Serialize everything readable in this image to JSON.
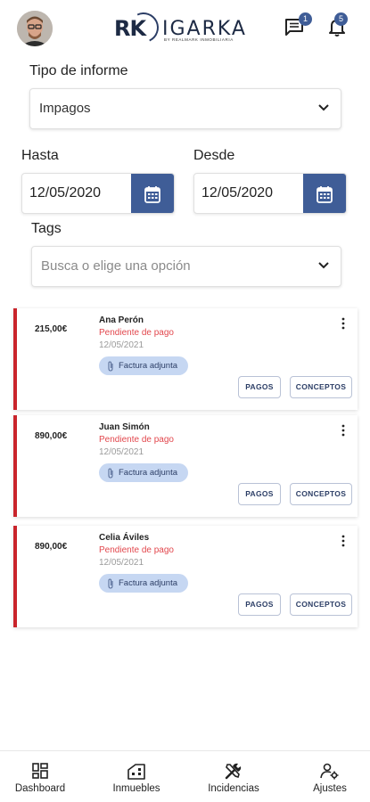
{
  "header": {
    "logo_mark": "RK",
    "logo_name": "IGARKA",
    "logo_tagline": "BY REALMARK INMOBILIARIA",
    "chat_badge": "1",
    "notifications_badge": "5"
  },
  "form": {
    "report_type_label": "Tipo de informe",
    "report_type_value": "Impagos",
    "to_label": "Hasta",
    "to_value": "12/05/2020",
    "from_label": "Desde",
    "from_value": "12/05/2020",
    "tags_label": "Tags",
    "tags_placeholder": "Busca o elige una opción"
  },
  "cards": [
    {
      "amount": "215,00€",
      "name": "Ana Perón",
      "status": "Pendiente de pago",
      "date": "12/05/2021",
      "chip": "Factura adjunta",
      "pagos": "PAGOS",
      "conceptos": "CONCEPTOS"
    },
    {
      "amount": "890,00€",
      "name": "Juan Simón",
      "status": "Pendiente de pago",
      "date": "12/05/2021",
      "chip": "Factura adjunta",
      "pagos": "PAGOS",
      "conceptos": "CONCEPTOS"
    },
    {
      "amount": "890,00€",
      "name": "Celia Áviles",
      "status": "Pendiente de pago",
      "date": "12/05/2021",
      "chip": "Factura adjunta",
      "pagos": "PAGOS",
      "conceptos": "CONCEPTOS"
    }
  ],
  "nav": {
    "dashboard": "Dashboard",
    "inmuebles": "Inmuebles",
    "incidencias": "Incidencias",
    "ajustes": "Ajustes"
  },
  "colors": {
    "primary": "#3f5d97",
    "accent_red": "#c9242b",
    "status_red": "#e2474d",
    "chip_bg": "#c6d7f2"
  }
}
